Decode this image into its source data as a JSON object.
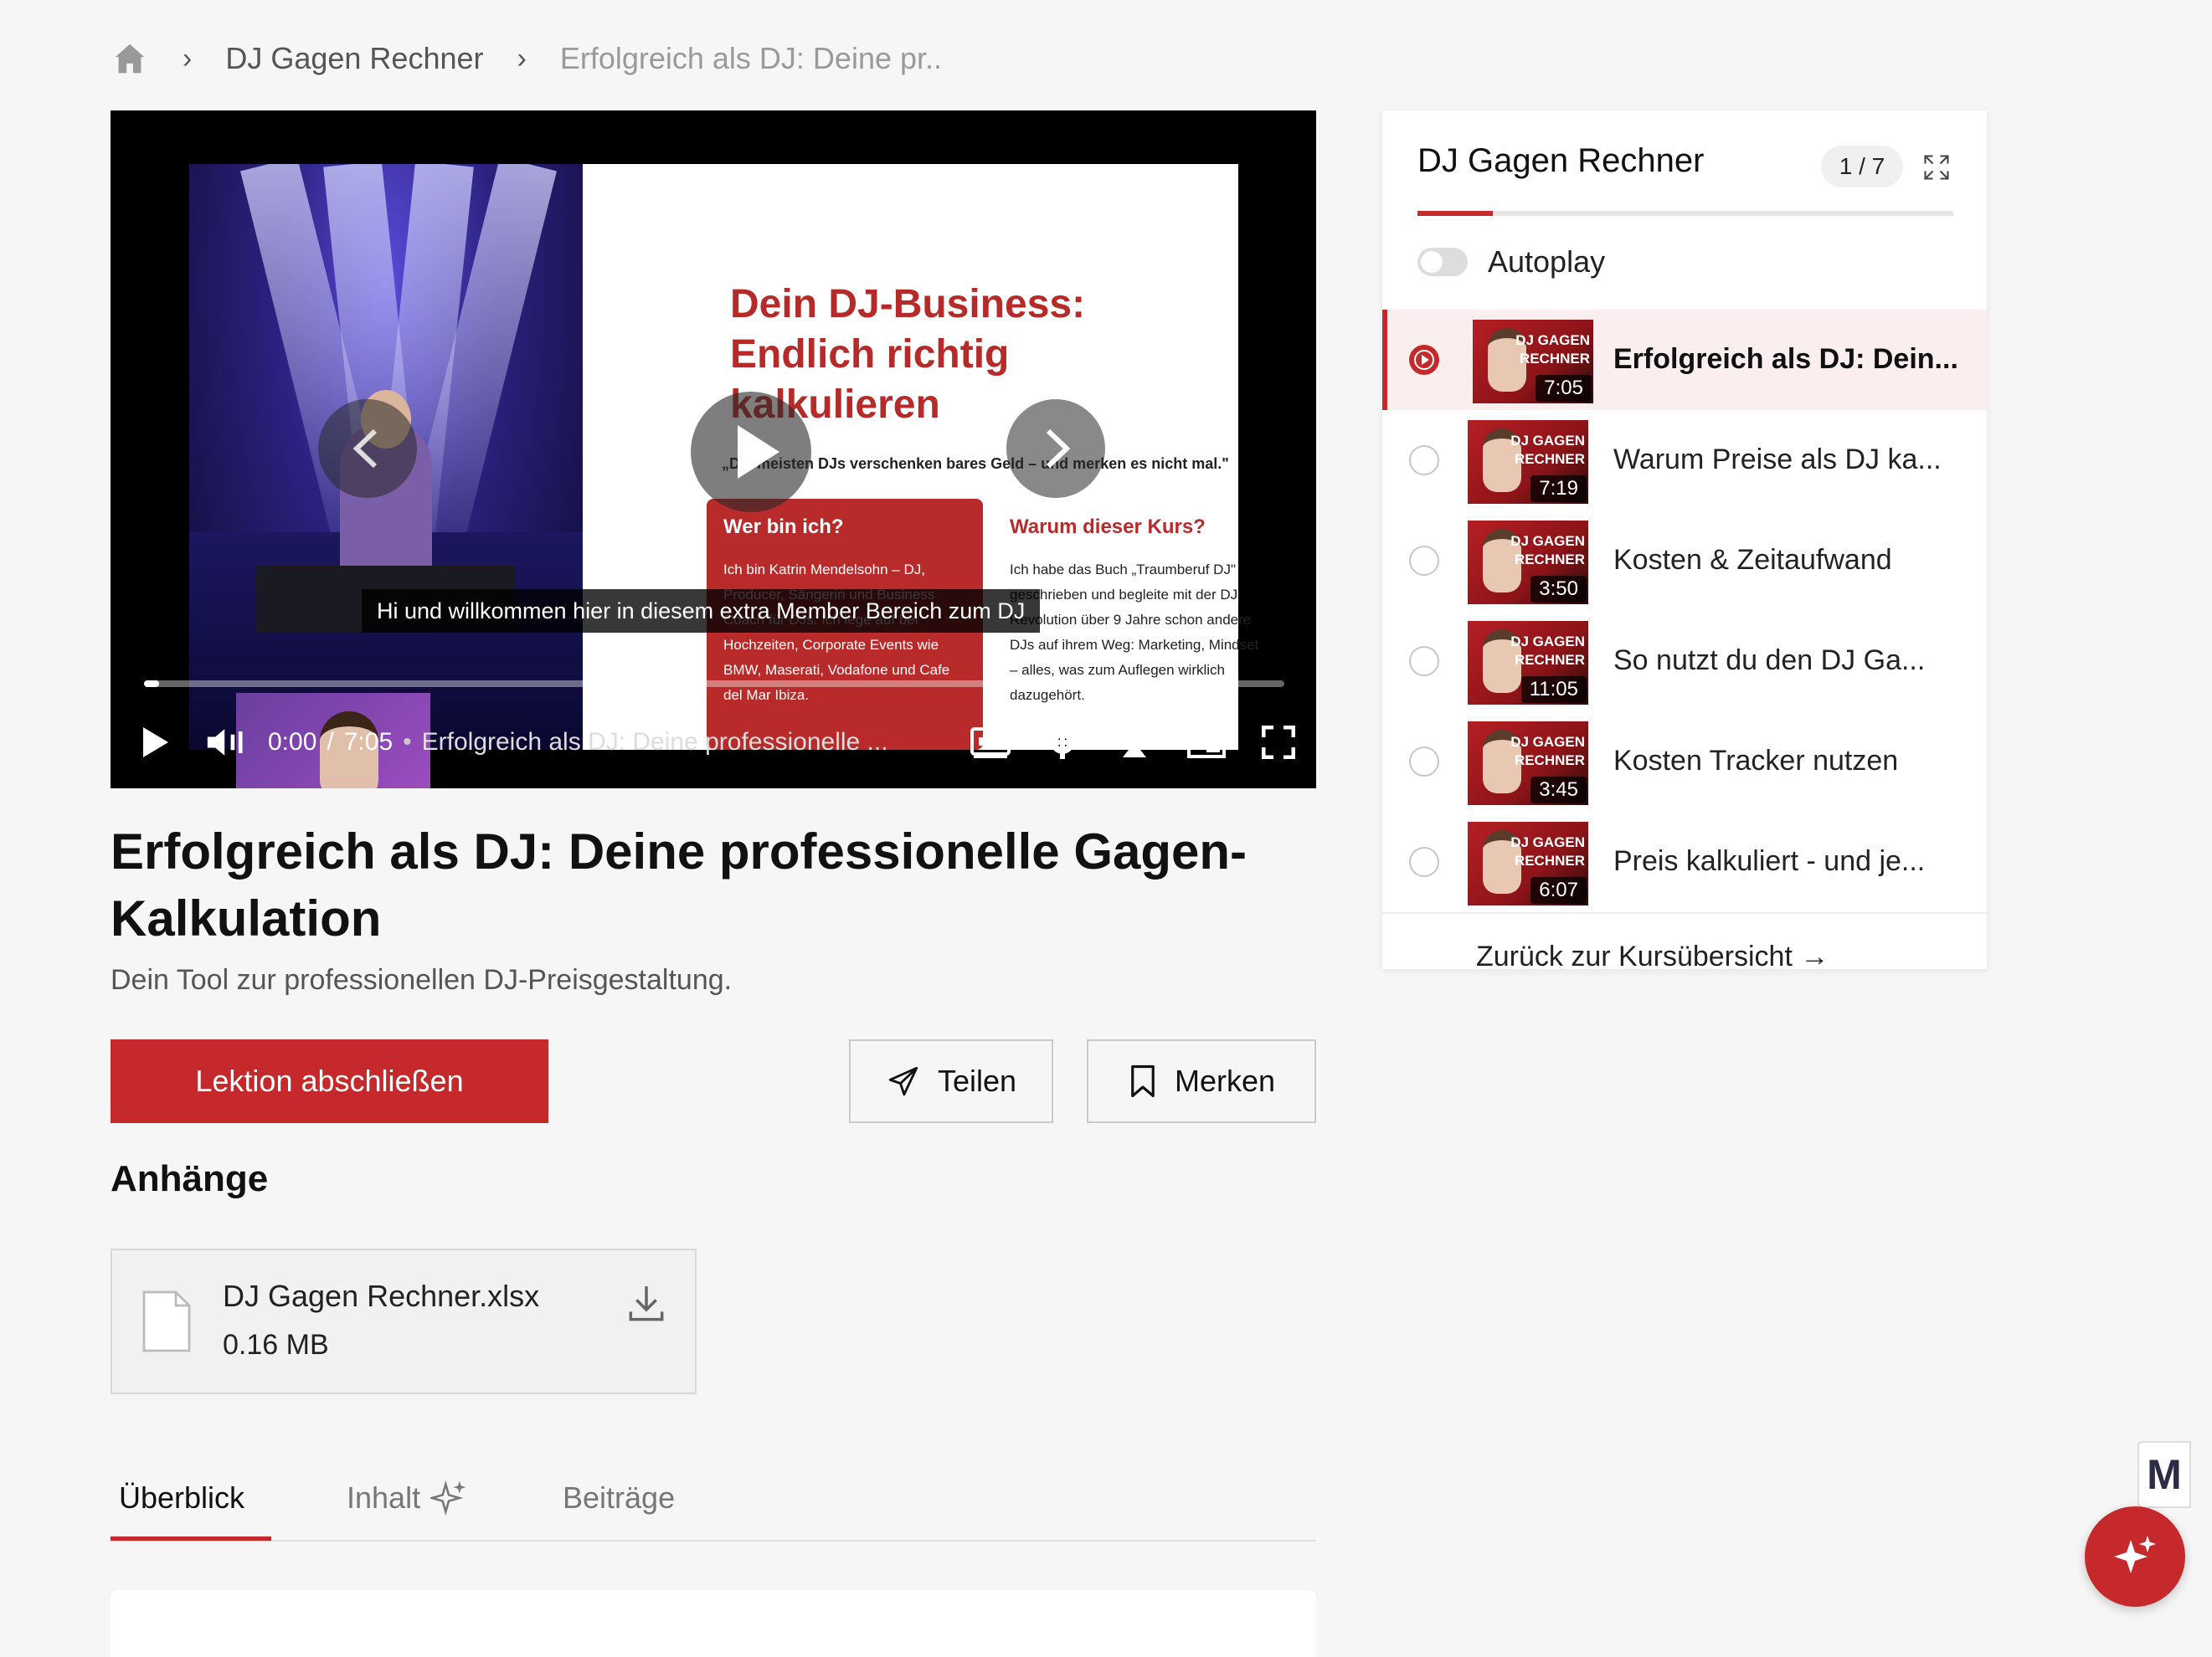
{
  "breadcrumb": {
    "item1": "DJ Gagen Rechner",
    "item2": "Erfolgreich als DJ: Deine pr.."
  },
  "video": {
    "slide_title": "Dein DJ-Business: Endlich richtig kalkulieren",
    "slide_quote": "„Die meisten DJs verschenken bares Geld – und merken es nicht mal.\"",
    "box1_heading": "Wer bin ich?",
    "box1_text": "Ich bin Katrin Mendelsohn – DJ, Producer, Sängerin und Business Coach für DJs. Ich lege auf bei Hochzeiten, Corporate Events wie BMW, Maserati, Vodafone und Cafe del Mar Ibiza.",
    "box2_heading": "Warum dieser Kurs?",
    "box2_text": "Ich habe das Buch „Traumberuf DJ\" geschrieben und begleite mit der DJ Revolution über 9 Jahre schon andere DJs auf ihrem Weg: Marketing, Mindset – alles, was zum Auflegen wirklich dazugehört.",
    "caption": "Hi und willkommen hier in diesem extra Member Bereich zum DJ",
    "current_time": "0:00",
    "duration": "7:05",
    "separator": "/",
    "title_dot": "•",
    "video_title": "Erfolgreich als DJ: Deine professionelle ...",
    "progress": 0.0
  },
  "lesson": {
    "title": "Erfolgreich als DJ: Deine professionelle Gagen-Kalkulation",
    "subtitle": "Dein Tool zur professionellen DJ-Preisgestaltung.",
    "complete_button": "Lektion abschließen",
    "share_button": "Teilen",
    "save_button": "Merken"
  },
  "attachments": {
    "heading": "Anhänge",
    "files": [
      {
        "name": "DJ Gagen Rechner.xlsx",
        "size": "0.16 MB"
      }
    ]
  },
  "tabs": [
    {
      "label": "Überblick",
      "active": true
    },
    {
      "label": "Inhalt",
      "active": false
    },
    {
      "label": "Beiträge",
      "active": false
    }
  ],
  "sidebar": {
    "title": "DJ Gagen Rechner",
    "count": "1 / 7",
    "progress": 0.14,
    "autoplay_label": "Autoplay",
    "autoplay_on": false,
    "thumb_brand": "DJ GAGEN\nRECHNER",
    "lessons": [
      {
        "title": "Erfolgreich als DJ: Dein...",
        "duration": "7:05",
        "active": true
      },
      {
        "title": "Warum Preise als DJ ka...",
        "duration": "7:19",
        "active": false
      },
      {
        "title": "Kosten & Zeitaufwand",
        "duration": "3:50",
        "active": false
      },
      {
        "title": "So nutzt du den DJ Ga...",
        "duration": "11:05",
        "active": false
      },
      {
        "title": "Kosten Tracker nutzen",
        "duration": "3:45",
        "active": false
      },
      {
        "title": "Preis kalkuliert - und je...",
        "duration": "6:07",
        "active": false
      }
    ],
    "back_link": "Zurück zur Kursübersicht →"
  },
  "floating": {
    "badge_letter": "M"
  },
  "colors": {
    "accent": "#c5292b",
    "background": "#f6f6f6"
  }
}
